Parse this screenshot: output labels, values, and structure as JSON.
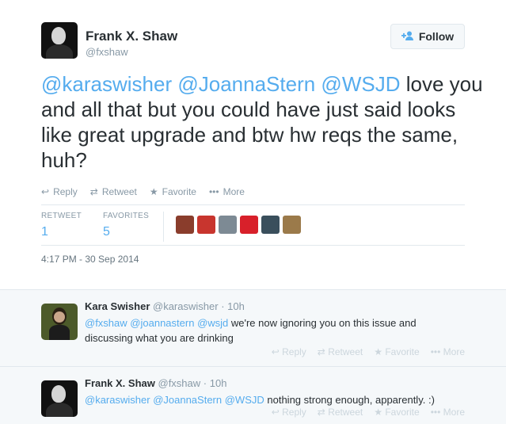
{
  "tweet": {
    "author_name": "Frank X. Shaw",
    "author_handle": "@fxshaw",
    "follow_label": "Follow",
    "text_parts": {
      "m1": "@karaswisher",
      "m2": "@JoannaStern",
      "m3": "@WSJD",
      "body": " love you and all that but you could have just said looks like great upgrade and btw hw reqs the same, huh?"
    },
    "actions": {
      "reply": "Reply",
      "retweet": "Retweet",
      "favorite": "Favorite",
      "more": "More"
    },
    "stats": {
      "retweet_label": "RETWEET",
      "retweet_count": "1",
      "favorites_label": "FAVORITES",
      "favorites_count": "5"
    },
    "favoriter_colors": [
      "#8a3d2c",
      "#c8352e",
      "#7d8a94",
      "#d8202a",
      "#3a4f5c",
      "#9b7a4a"
    ],
    "timestamp": "4:17 PM - 30 Sep 2014"
  },
  "replies": [
    {
      "name": "Kara Swisher",
      "handle": "@karaswisher",
      "time": "· 10h",
      "m1": "@fxshaw",
      "m2": "@joannastern",
      "m3": "@wsjd",
      "body": " we're now ignoring you on this issue and discussing what you are drinking"
    },
    {
      "name": "Frank X. Shaw",
      "handle": "@fxshaw",
      "time": "· 10h",
      "m1": "@karaswisher",
      "m2": "@JoannaStern",
      "m3": "@WSJD",
      "body": " nothing strong enough, apparently. :)"
    }
  ],
  "reply_actions": {
    "reply": "Reply",
    "retweet": "Retweet",
    "favorite": "Favorite",
    "more": "More"
  },
  "colors": {
    "accent": "#55acee",
    "text": "#292f33",
    "muted": "#8899a6"
  }
}
